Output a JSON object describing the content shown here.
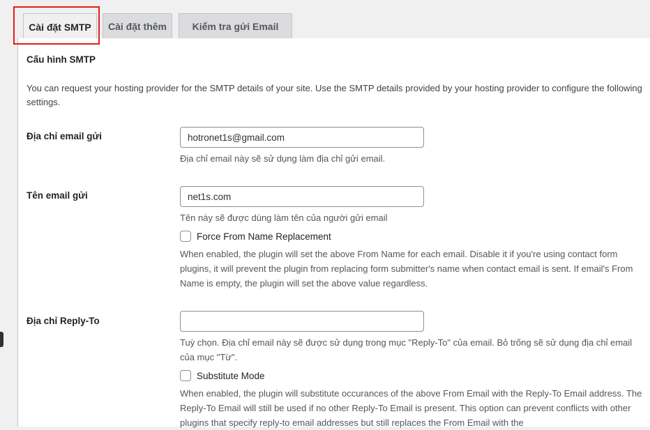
{
  "tabs": [
    {
      "label": "Cài đặt SMTP",
      "active": true
    },
    {
      "label": "Cài đặt thêm",
      "active": false
    },
    {
      "label": "Kiểm tra gửi Email",
      "active": false
    }
  ],
  "highlight_color": "#e41b1b",
  "section": {
    "title": "Cấu hình SMTP",
    "intro": "You can request your hosting provider for the SMTP details of your site. Use the SMTP details provided by your hosting provider to configure the following settings."
  },
  "fields": {
    "from_email": {
      "label": "Địa chỉ email gửi",
      "value": "hotronet1s@gmail.com",
      "description": "Địa chỉ email này sẽ sử dụng làm địa chỉ gửi email."
    },
    "from_name": {
      "label": "Tên email gửi",
      "value": "net1s.com",
      "description": "Tên này sẽ được dùng làm tên của người gửi email",
      "checkbox_label": "Force From Name Replacement",
      "checkbox_checked": false,
      "checkbox_description": "When enabled, the plugin will set the above From Name for each email. Disable it if you're using contact form plugins, it will prevent the plugin from replacing form submitter's name when contact email is sent. If email's From Name is empty, the plugin will set the above value regardless."
    },
    "reply_to": {
      "label": "Địa chỉ Reply-To",
      "value": "",
      "description": "Tuỳ chọn. Địa chỉ email này sẽ được sử dụng trong mục \"Reply-To\" của email. Bỏ trống sẽ sử dụng địa chỉ email của mục \"Từ\".",
      "checkbox_label": "Substitute Mode",
      "checkbox_checked": false,
      "checkbox_description": "When enabled, the plugin will substitute occurances of the above From Email with the Reply-To Email address. The Reply-To Email will still be used if no other Reply-To Email is present. This option can prevent conflicts with other plugins that specify reply-to email addresses but still replaces the From Email with the"
    }
  }
}
